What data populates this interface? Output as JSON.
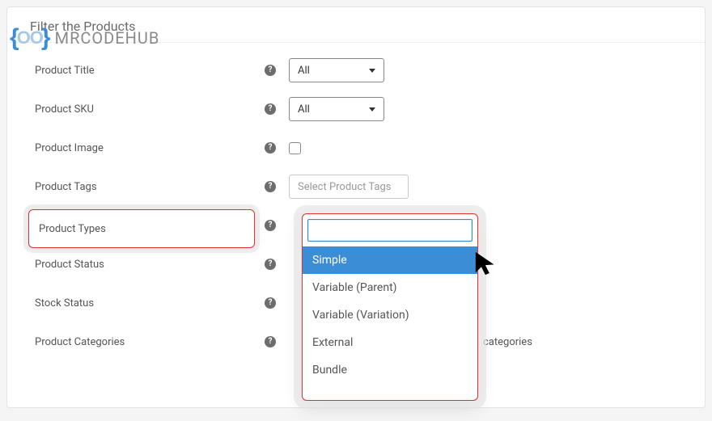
{
  "watermark": {
    "brand": "MRCODEHUB"
  },
  "header": {
    "title": "Filter the Products"
  },
  "rows": {
    "title": {
      "label": "Product Title",
      "value": "All"
    },
    "sku": {
      "label": "Product SKU",
      "value": "All"
    },
    "image": {
      "label": "Product Image"
    },
    "tags": {
      "label": "Product Tags",
      "placeholder": "Select Product Tags"
    },
    "types": {
      "label": "Product Types"
    },
    "status": {
      "label": "Product Status"
    },
    "stock": {
      "label": "Stock Status"
    },
    "cats": {
      "label": "Product Categories",
      "suffix": "categories"
    }
  },
  "dropdown": {
    "options": {
      "0": "Simple",
      "1": "Variable (Parent)",
      "2": "Variable (Variation)",
      "3": "External",
      "4": "Bundle"
    },
    "selected_index": 0
  }
}
